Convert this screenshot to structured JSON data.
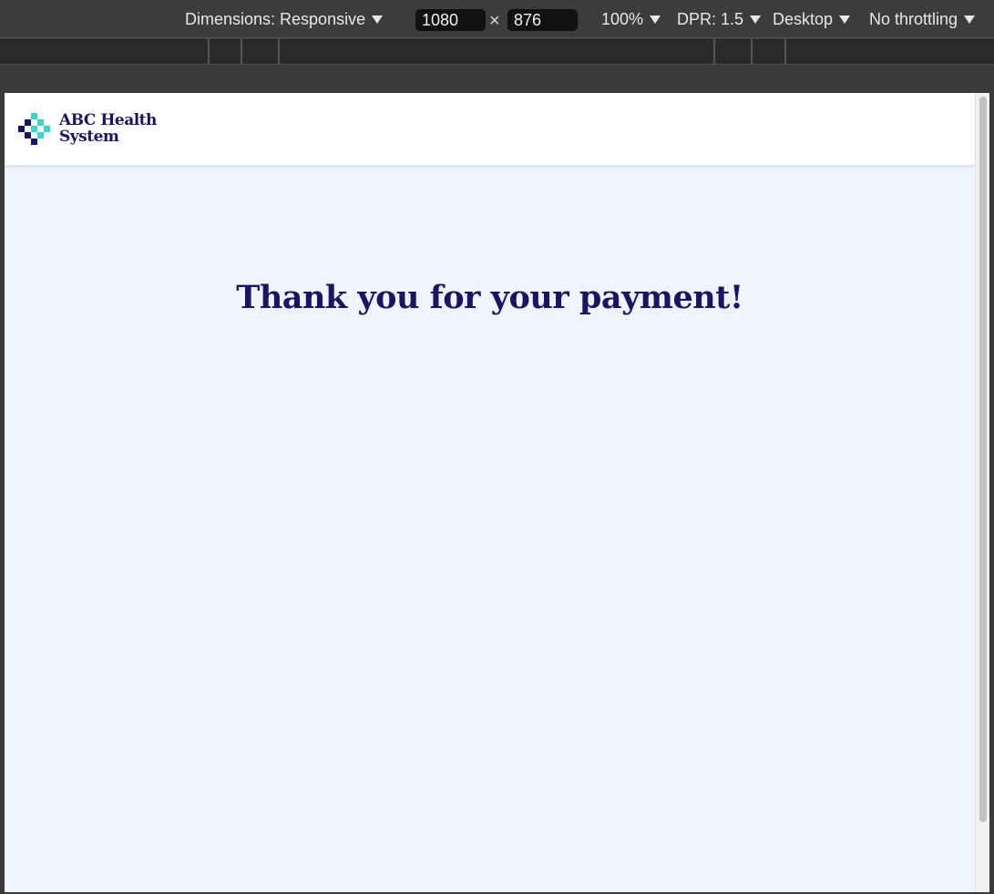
{
  "devtools": {
    "dimensions_label": "Dimensions: Responsive",
    "width_value": "1080",
    "times_symbol": "×",
    "height_value": "876",
    "zoom_label": "100%",
    "dpr_label": "DPR: 1.5",
    "device_type_label": "Desktop",
    "throttling_label": "No throttling"
  },
  "site": {
    "logo_line1": "ABC Health",
    "logo_line2": "System",
    "brand_navy": "#1b1464",
    "brand_teal": "#3ad6c5",
    "background": "#eef5fd"
  },
  "main": {
    "title": "Thank you for your payment!"
  }
}
